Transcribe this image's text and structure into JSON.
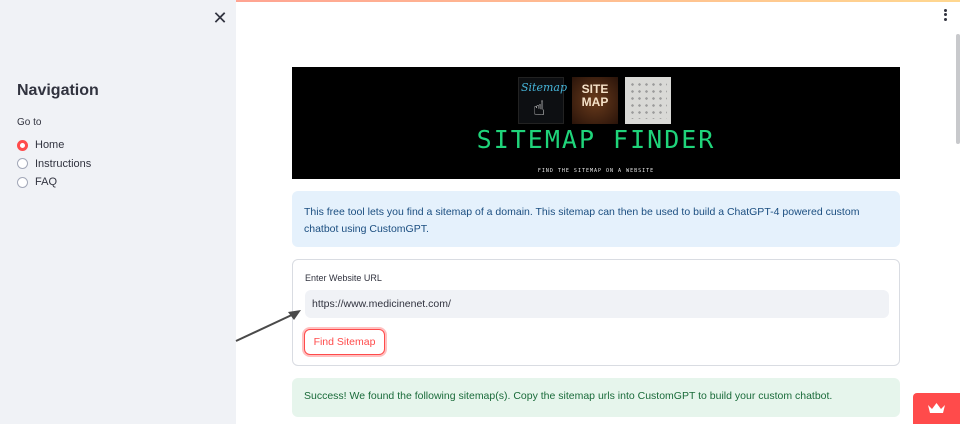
{
  "sidebar": {
    "close_icon": "close-icon",
    "title": "Navigation",
    "goto_label": "Go to",
    "options": [
      {
        "label": "Home",
        "selected": true
      },
      {
        "label": "Instructions",
        "selected": false
      },
      {
        "label": "FAQ",
        "selected": false
      }
    ]
  },
  "header": {
    "menu_icon": "vertical-dots-icon"
  },
  "banner": {
    "thumb1_text": "Sitemap",
    "thumb2_text": "SITE MAP",
    "title": "SITEMAP FINDER",
    "subtitle": "FIND THE SITEMAP ON A WEBSITE"
  },
  "main": {
    "info_text": "This free tool lets you find a sitemap of a domain. This sitemap can then be used to build a ChatGPT-4 powered custom chatbot using CustomGPT.",
    "url_label": "Enter Website URL",
    "url_value": "https://www.medicinenet.com/",
    "find_button": "Find Sitemap",
    "success_text": "Success! We found the following sitemap(s). Copy the sitemap urls into CustomGPT to build your custom chatbot."
  },
  "colors": {
    "accent": "#ff4b4b",
    "sidebar_bg": "#f0f2f6",
    "info_bg": "#e5f1fc",
    "success_bg": "#e6f5ec",
    "banner_title": "#1fd47a"
  }
}
